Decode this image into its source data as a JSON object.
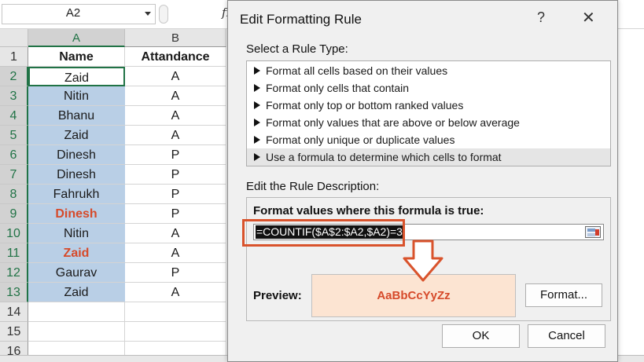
{
  "formula_bar": {
    "name_box": "A2",
    "fx_label": "fx"
  },
  "columns": [
    "A",
    "B"
  ],
  "rows": [
    {
      "num": "1",
      "a": "Name",
      "b": "Attandance",
      "header": true
    },
    {
      "num": "2",
      "a": "Zaid",
      "b": "A",
      "active": true
    },
    {
      "num": "3",
      "a": "Nitin",
      "b": "A"
    },
    {
      "num": "4",
      "a": "Bhanu",
      "b": "A"
    },
    {
      "num": "5",
      "a": "Zaid",
      "b": "A"
    },
    {
      "num": "6",
      "a": "Dinesh",
      "b": "P"
    },
    {
      "num": "7",
      "a": "Dinesh",
      "b": "P"
    },
    {
      "num": "8",
      "a": "Fahrukh",
      "b": "P"
    },
    {
      "num": "9",
      "a": "Dinesh",
      "b": "P",
      "highlight": true
    },
    {
      "num": "10",
      "a": "Nitin",
      "b": "A"
    },
    {
      "num": "11",
      "a": "Zaid",
      "b": "A",
      "highlight": true
    },
    {
      "num": "12",
      "a": "Gaurav",
      "b": "P"
    },
    {
      "num": "13",
      "a": "Zaid",
      "b": "A"
    },
    {
      "num": "14",
      "a": "",
      "b": ""
    },
    {
      "num": "15",
      "a": "",
      "b": ""
    },
    {
      "num": "16",
      "a": "",
      "b": ""
    }
  ],
  "dialog": {
    "title": "Edit Formatting Rule",
    "help": "?",
    "close": "✕",
    "select_rule_type_label": "Select a Rule Type:",
    "rule_types": [
      "Format all cells based on their values",
      "Format only cells that contain",
      "Format only top or bottom ranked values",
      "Format only values that are above or below average",
      "Format only unique or duplicate values",
      "Use a formula to determine which cells to format"
    ],
    "selected_rule_index": 5,
    "edit_description_label": "Edit the Rule Description:",
    "formula_label": "Format values where this formula is true:",
    "formula_value": "=COUNTIF($A$2:$A2,$A2)=3",
    "preview_label": "Preview:",
    "preview_sample": "AaBbCcYyZz",
    "format_button": "Format...",
    "ok_button": "OK",
    "cancel_button": "Cancel"
  },
  "colors": {
    "selection": "#b9cfe6",
    "highlight_text": "#d64a2a",
    "preview_fill": "#fce4d2",
    "annotation": "#d9532c"
  }
}
